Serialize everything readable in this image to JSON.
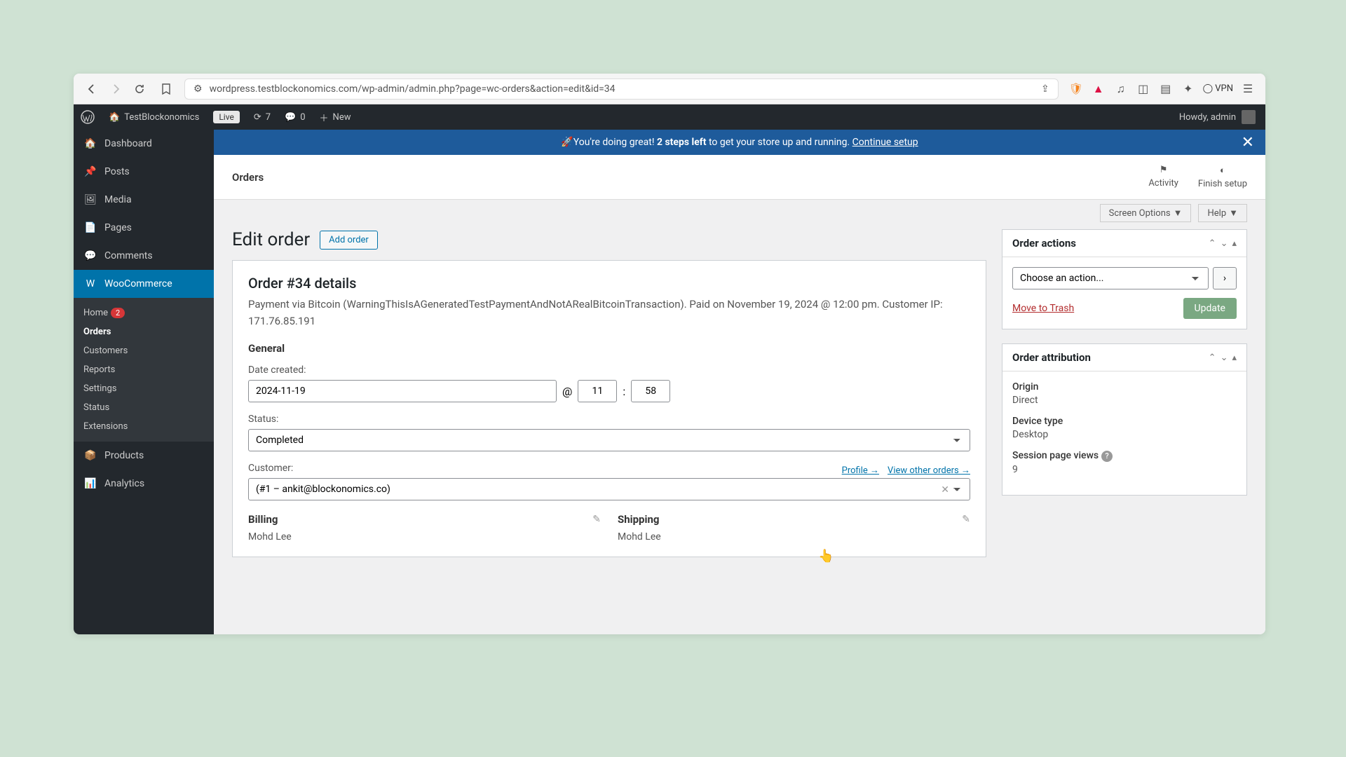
{
  "browser": {
    "url": "wordpress.testblockonomics.com/wp-admin/admin.php?page=wc-orders&action=edit&id=34",
    "vpn": "VPN"
  },
  "topbar": {
    "site": "TestBlockonomics",
    "live": "Live",
    "refresh_count": "7",
    "comments_count": "0",
    "new": "New",
    "howdy": "Howdy, admin"
  },
  "sidebar": {
    "dashboard": "Dashboard",
    "posts": "Posts",
    "media": "Media",
    "pages": "Pages",
    "comments": "Comments",
    "woocommerce": "WooCommerce",
    "products": "Products",
    "analytics": "Analytics",
    "sub": {
      "home": "Home",
      "home_badge": "2",
      "orders": "Orders",
      "customers": "Customers",
      "reports": "Reports",
      "settings": "Settings",
      "status": "Status",
      "extensions": "Extensions"
    }
  },
  "banner": {
    "text_pre": "You're doing great! ",
    "text_bold": "2 steps left",
    "text_post": " to get your store up and running. ",
    "link": "Continue setup"
  },
  "header": {
    "title": "Orders",
    "activity": "Activity",
    "finish": "Finish setup"
  },
  "tabs": {
    "screen_options": "Screen Options",
    "help": "Help"
  },
  "page": {
    "title": "Edit order",
    "add_order": "Add order"
  },
  "order": {
    "heading": "Order #34 details",
    "meta": "Payment via Bitcoin (WarningThisIsAGeneratedTestPaymentAndNotARealBitcoinTransaction). Paid on November 19, 2024 @ 12:00 pm. Customer IP: 171.76.85.191",
    "general": "General",
    "date_label": "Date created:",
    "date": "2024-11-19",
    "at": "@",
    "hour": "11",
    "colon": ":",
    "min": "58",
    "status_label": "Status:",
    "status": "Completed",
    "customer_label": "Customer:",
    "profile": "Profile →",
    "view_orders": "View other orders →",
    "customer": "(#1 – ankit@blockonomics.co)",
    "billing": "Billing",
    "shipping": "Shipping",
    "billing_name": "Mohd Lee",
    "shipping_name": "Mohd Lee"
  },
  "actions_box": {
    "title": "Order actions",
    "choose": "Choose an action...",
    "trash": "Move to Trash",
    "update": "Update"
  },
  "attr_box": {
    "title": "Order attribution",
    "origin_l": "Origin",
    "origin_v": "Direct",
    "device_l": "Device type",
    "device_v": "Desktop",
    "views_l": "Session page views",
    "views_v": "9"
  }
}
